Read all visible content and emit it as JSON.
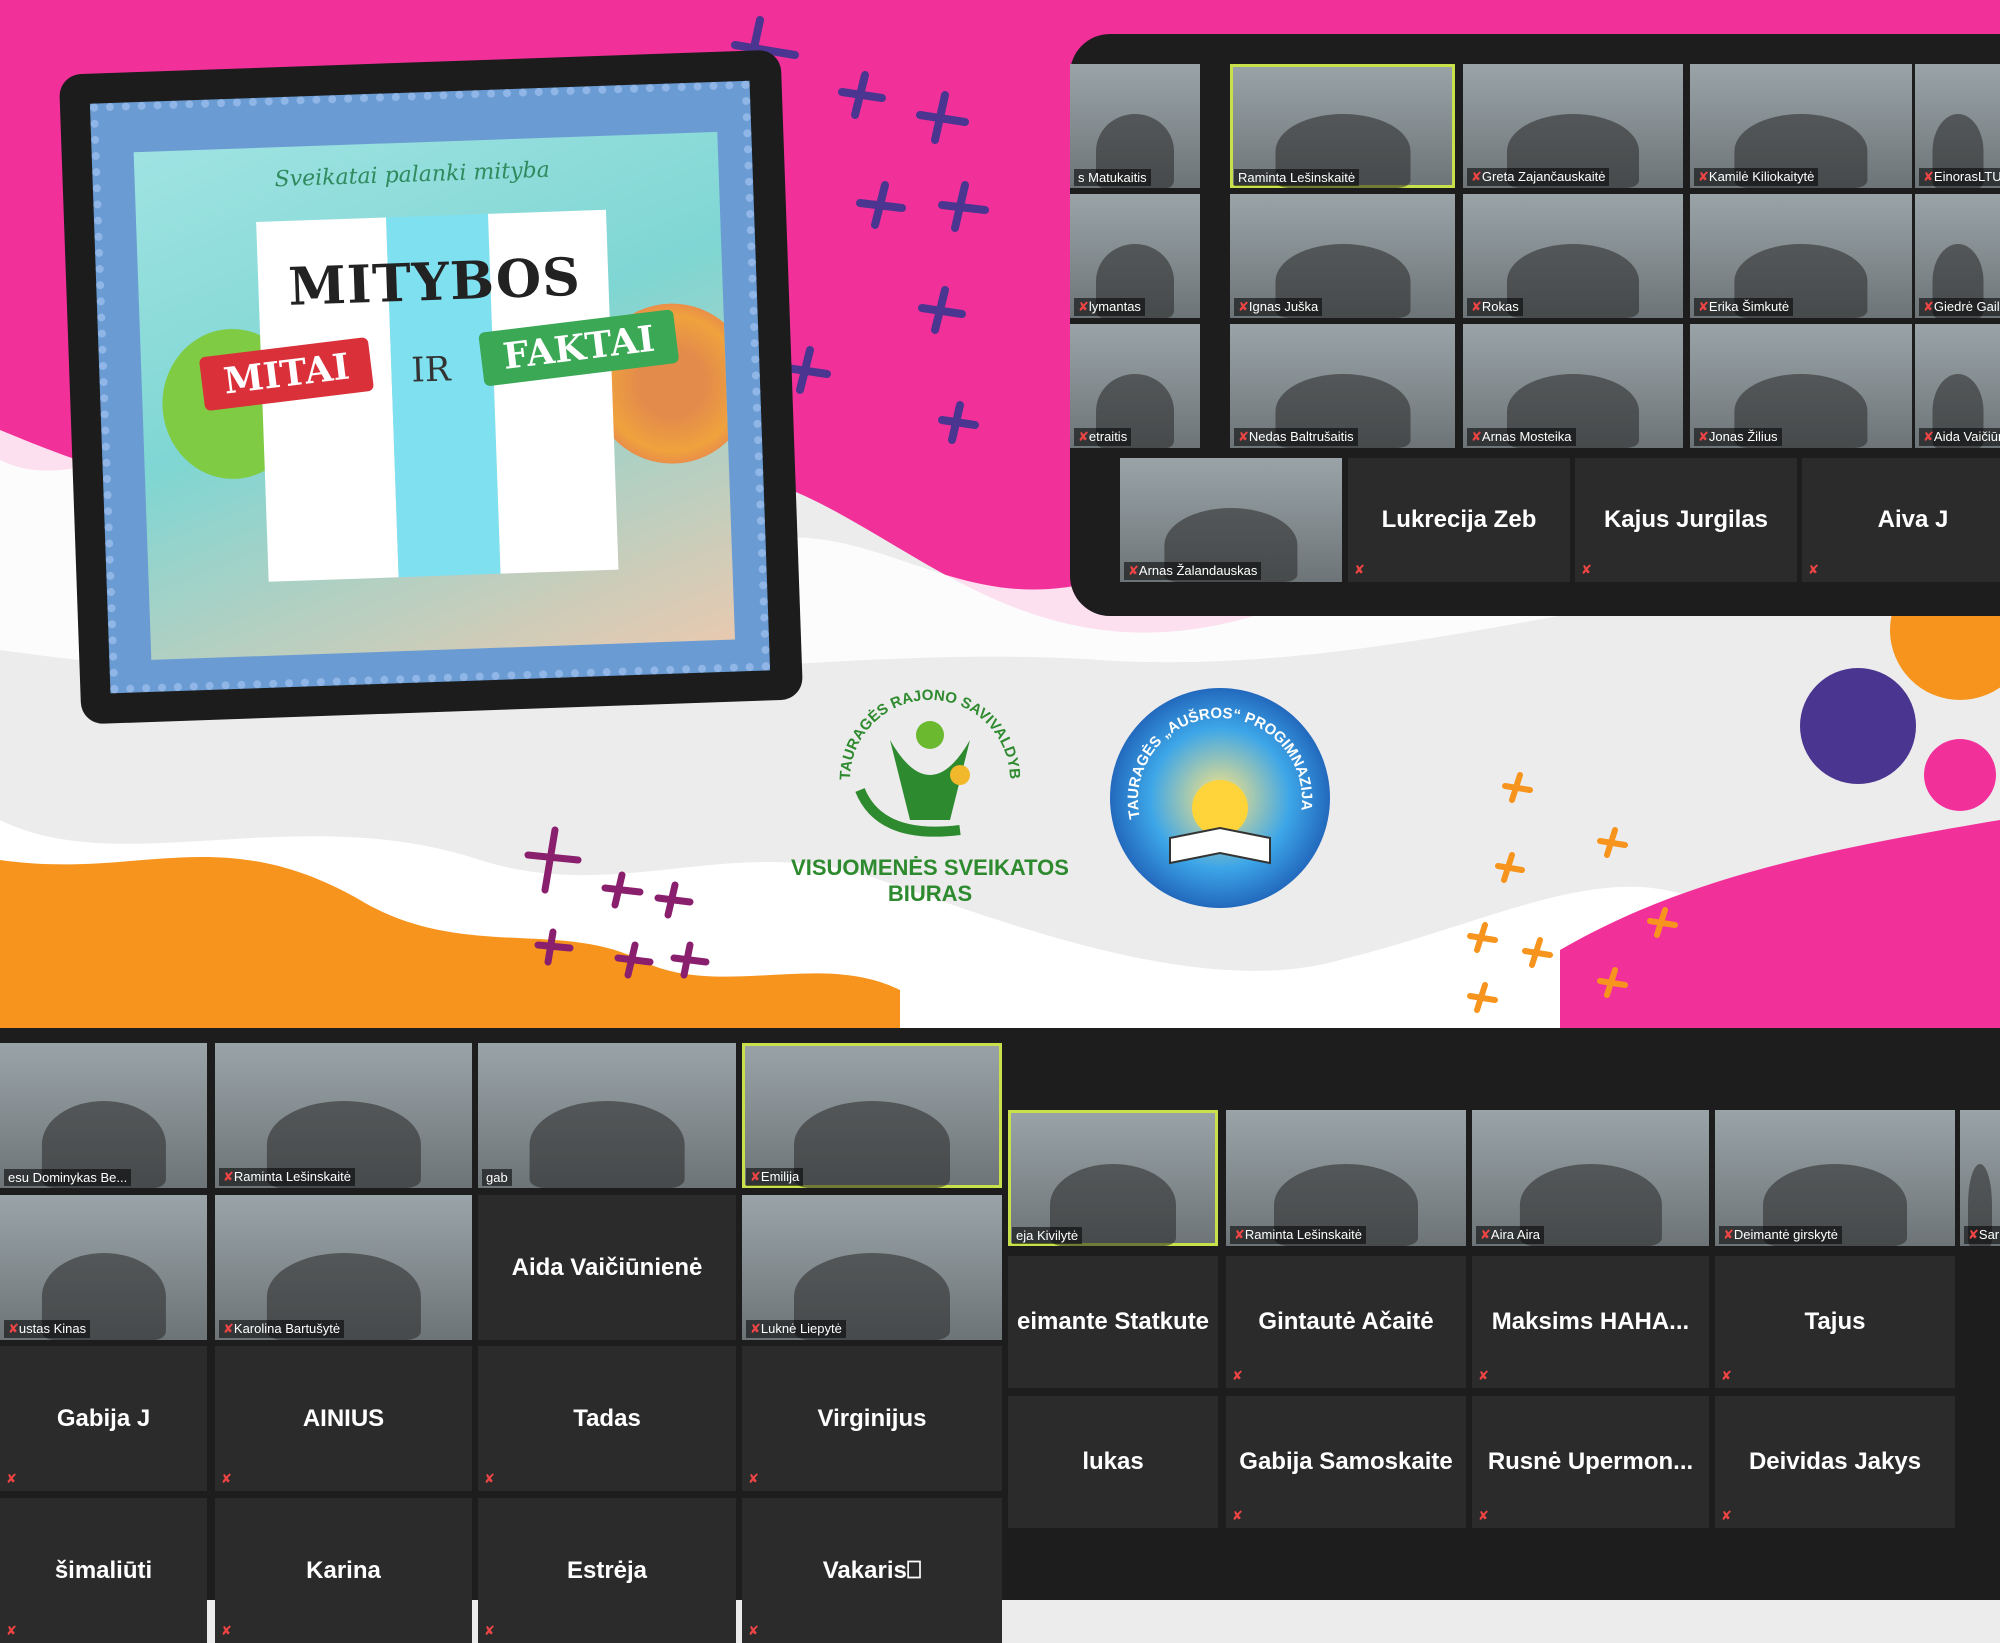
{
  "poster": {
    "subtitle": "Sveikatai palanki mityba",
    "title": "MITYBOS",
    "tag_left": "MITAI",
    "tag_mid": "IR",
    "tag_right": "FAKTAI"
  },
  "logos": {
    "municipality_ring": "TAURAGĖS RAJONO SAVIVALDYBĖS",
    "municipality_text": "VISUOMENĖS SVEIKATOS BIURAS",
    "school_ring": "TAURAGĖS „AUŠROS“ PROGIMNAZIJA"
  },
  "colors": {
    "pink": "#f2309a",
    "orange": "#f7941d",
    "purple": "#4a3590",
    "panel": "#1d1d1d",
    "speaker": "#c8e04a",
    "logo_green": "#2e8a2e"
  },
  "top_right": [
    "s Matukaitis",
    "Raminta Lešinskaitė",
    "Greta Zajančauskaitė",
    "Kamilė Kiliokaitytė",
    "EinorasLTU",
    "lymantas",
    "Ignas Juška",
    "Rokas",
    "Erika Šimkutė",
    "Giedrė Gail",
    "etraitis",
    "Nedas Baltrušaitis",
    "Arnas Mosteika",
    "Jonas Žilius",
    "Aida Vaičiūnie",
    "Arnas Žalandauskas",
    "Lukrecija Zeb",
    "Kajus Jurgilas",
    "Aiva J"
  ],
  "bottom_left": [
    "esu Dominykas Be...",
    "Raminta Lešinskaitė",
    "gab",
    "Emilija",
    "ustas Kinas",
    "Karolina Bartušytė",
    "Aida Vaičiūnienė",
    "Luknė Liepytė",
    "Gabija J",
    "AINIUS",
    "Tadas",
    "Virginijus",
    "šimaliūti",
    "Karina",
    "Estrėja",
    "Vakaris⎕"
  ],
  "bottom_right": [
    "eja Kivilytė",
    "Raminta Lešinskaitė",
    "Aira Aira",
    "Deimantė girskytė",
    "Sar",
    "eimante Statkute",
    "Gintautė Ačaitė",
    "Maksims  HAHA...",
    "Tajus",
    "lukas",
    "Gabija Samoskaite",
    "Rusnė  Upermon...",
    "Deividas Jakys"
  ]
}
